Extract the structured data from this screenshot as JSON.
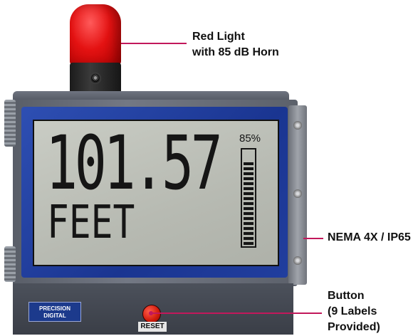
{
  "callouts": {
    "light_line1": "Red Light",
    "light_line2": "with 85 dB Horn",
    "nema": "NEMA 4X / IP65",
    "button_line1": "Button",
    "button_line2": "(9 Labels",
    "button_line3": "Provided)"
  },
  "display": {
    "value": "101.57",
    "unit": "FEET",
    "percent_label": "85%",
    "bargraph_level": 85
  },
  "panel": {
    "logo_line1": "PRECISION",
    "logo_line2": "DIGITAL",
    "reset_label": "RESET"
  },
  "colors": {
    "beacon": "#e41212",
    "bezel": "#1a3591",
    "callout_line": "#c2185b"
  }
}
